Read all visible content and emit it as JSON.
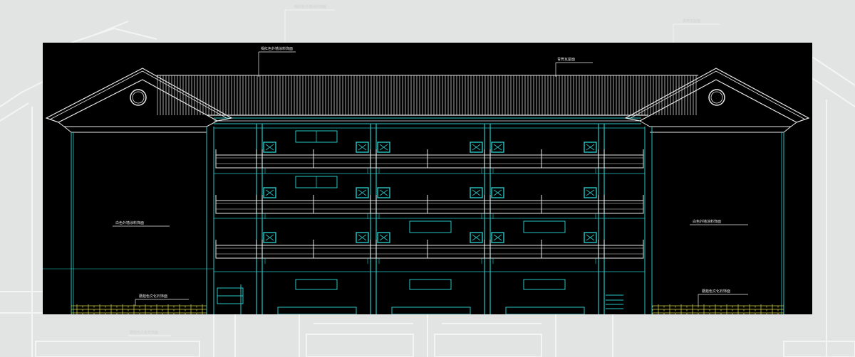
{
  "background_labels": {
    "top_left": "褐红色外墙涂料饰面",
    "top_right": "青筒瓦屋面",
    "bottom_left": "蘑菇色文化石饰面"
  },
  "drawing": {
    "label_roof_red": "褐红色外墙涂料饰面",
    "label_roof_tile": "青筒瓦屋面",
    "label_wall_left": "白色外墙涂料饰面",
    "label_wall_right": "白色外墙涂料饰面",
    "label_stone_left": "蘑菇色文化石饰面",
    "label_stone_right": "蘑菇色文化石饰面"
  },
  "colors": {
    "page_bg": "#e2e3e3",
    "canvas_bg": "#000000",
    "line_cyan": "#27c6c6",
    "line_white": "#e8e8e8",
    "stone_yellow": "#c8c43a",
    "ghost_lines": "#f4f5f5"
  }
}
